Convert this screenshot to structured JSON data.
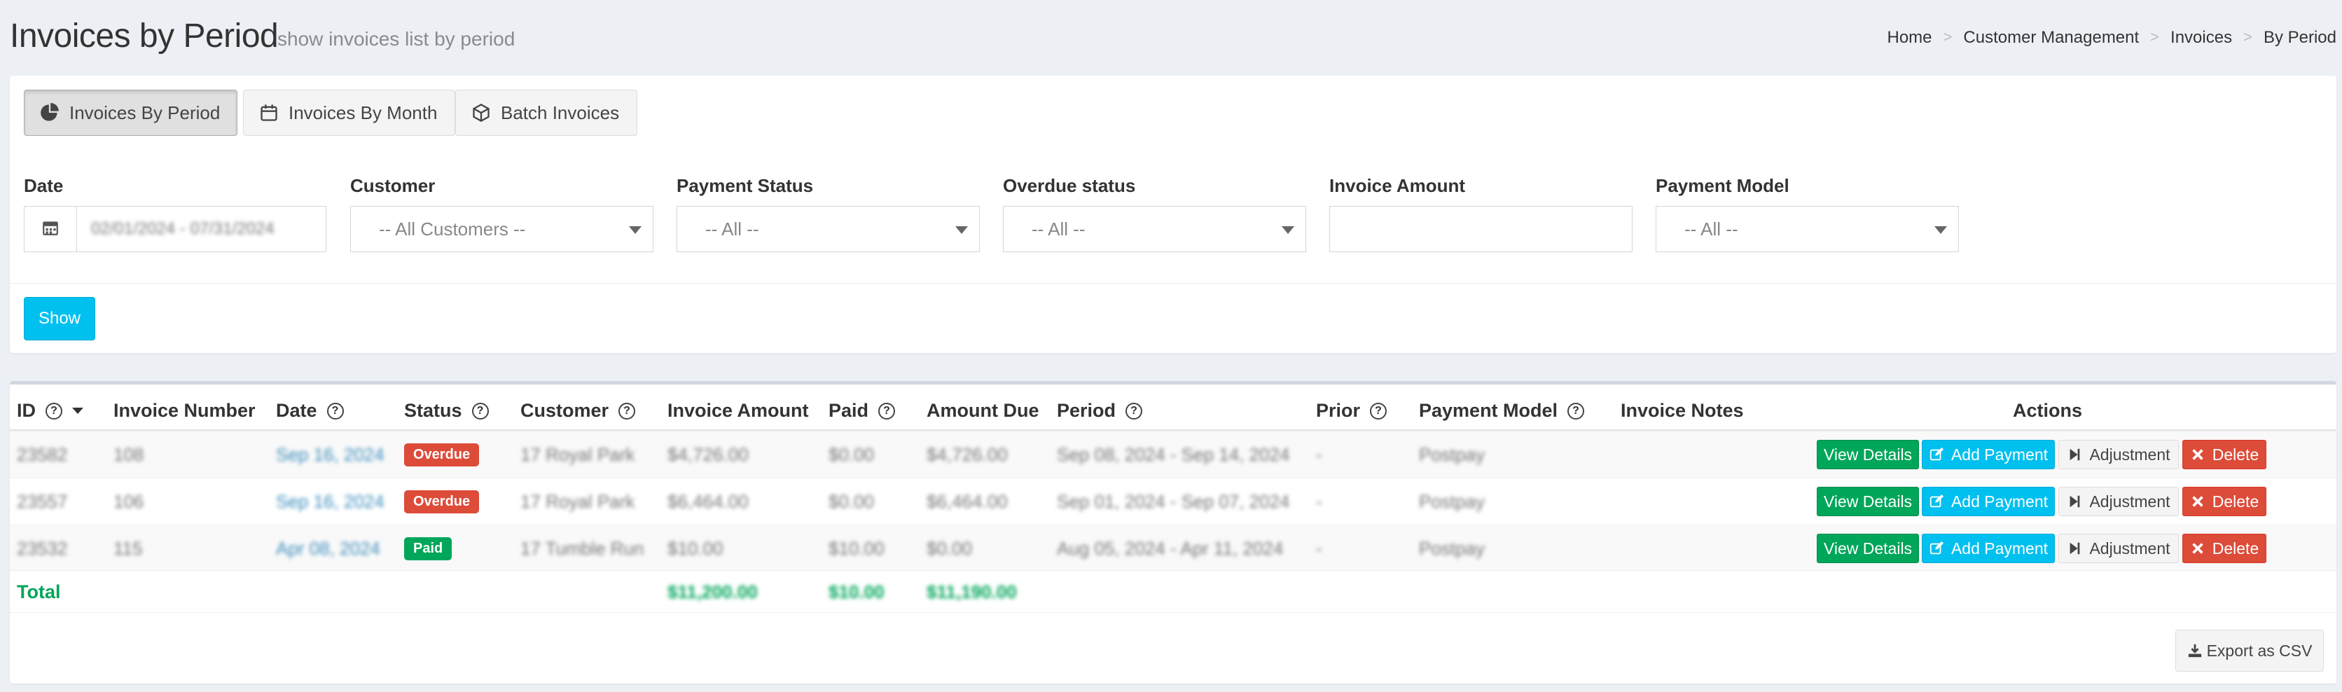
{
  "header": {
    "title": "Invoices by Period",
    "subtitle": "show invoices list by period",
    "breadcrumb": [
      "Home",
      "Customer Management",
      "Invoices",
      "By Period"
    ],
    "breadcrumb_sep": ">"
  },
  "tabs": [
    {
      "label": "Invoices By Period",
      "icon": "pie-chart-icon",
      "active": true
    },
    {
      "label": "Invoices By Month",
      "icon": "calendar-icon",
      "active": false
    },
    {
      "label": "Batch Invoices",
      "icon": "cube-icon",
      "active": false
    }
  ],
  "filters": {
    "date": {
      "label": "Date",
      "value": "02/01/2024 - 07/31/2024"
    },
    "customer": {
      "label": "Customer",
      "value": "-- All Customers --"
    },
    "payment_status": {
      "label": "Payment Status",
      "value": "-- All --"
    },
    "overdue_status": {
      "label": "Overdue status",
      "value": "-- All --"
    },
    "invoice_amount": {
      "label": "Invoice Amount",
      "value": ""
    },
    "payment_model": {
      "label": "Payment Model",
      "value": "-- All --"
    },
    "show_label": "Show"
  },
  "table": {
    "columns": {
      "id": "ID",
      "invoice_number": "Invoice Number",
      "date": "Date",
      "status": "Status",
      "customer": "Customer",
      "invoice_amount": "Invoice Amount",
      "paid": "Paid",
      "amount_due": "Amount Due",
      "period": "Period",
      "prior": "Prior",
      "payment_model": "Payment Model",
      "invoice_notes": "Invoice Notes",
      "actions": "Actions"
    },
    "help_glyph": "?",
    "rows": [
      {
        "id": "23582",
        "number": "108",
        "date": "Sep 16, 2024",
        "status": "Overdue",
        "status_type": "overdue",
        "customer": "17 Royal Park",
        "amount": "$4,726.00",
        "paid": "$0.00",
        "due": "$4,726.00",
        "period": "Sep 08, 2024 - Sep 14, 2024",
        "prior": "-",
        "model": "Postpay",
        "notes": ""
      },
      {
        "id": "23557",
        "number": "106",
        "date": "Sep 16, 2024",
        "status": "Overdue",
        "status_type": "overdue",
        "customer": "17 Royal Park",
        "amount": "$6,464.00",
        "paid": "$0.00",
        "due": "$6,464.00",
        "period": "Sep 01, 2024 - Sep 07, 2024",
        "prior": "-",
        "model": "Postpay",
        "notes": ""
      },
      {
        "id": "23532",
        "number": "115",
        "date": "Apr 08, 2024",
        "status": "Paid",
        "status_type": "paid",
        "customer": "17 Tumble Run",
        "amount": "$10.00",
        "paid": "$10.00",
        "due": "$0.00",
        "period": "Aug 05, 2024 - Apr 11, 2024",
        "prior": "-",
        "model": "Postpay",
        "notes": ""
      }
    ],
    "actions": {
      "view": "View Details",
      "pay": "Add Payment",
      "adjust": "Adjustment",
      "delete": "Delete"
    },
    "total": {
      "label": "Total",
      "amount": "$11,200.00",
      "paid": "$10.00",
      "due": "$11,190.00"
    },
    "export_label": "Export as CSV"
  }
}
